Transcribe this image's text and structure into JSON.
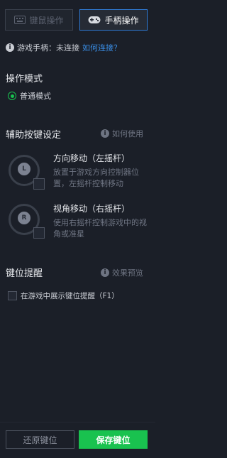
{
  "tabs": {
    "keyboard_label": "键鼠操作",
    "gamepad_label": "手柄操作"
  },
  "status": {
    "text": "游戏手柄：未连接",
    "link": "如何连接？"
  },
  "mode": {
    "title": "操作模式",
    "option": "普通模式"
  },
  "assist": {
    "title": "辅助按键设定",
    "help": "如何使用",
    "items": [
      {
        "icon": "L",
        "title": "方向移动（左摇杆）",
        "desc": "放置于游戏方向控制器位置，左摇杆控制移动"
      },
      {
        "icon": "R",
        "title": "视角移动（右摇杆）",
        "desc": "使用右摇杆控制游戏中的视角或准星"
      }
    ]
  },
  "reminder": {
    "title": "键位提醒",
    "help": "效果预览",
    "checkbox_label": "在游戏中展示键位提醒（F1）"
  },
  "footer": {
    "reset_label": "还原键位",
    "save_label": "保存键位"
  },
  "colors": {
    "background": "#1b1f28",
    "accent_blue": "#2f7bd6",
    "link_blue": "#3a8ee6",
    "save_green": "#19c24f",
    "radio_green": "#19c24f"
  }
}
